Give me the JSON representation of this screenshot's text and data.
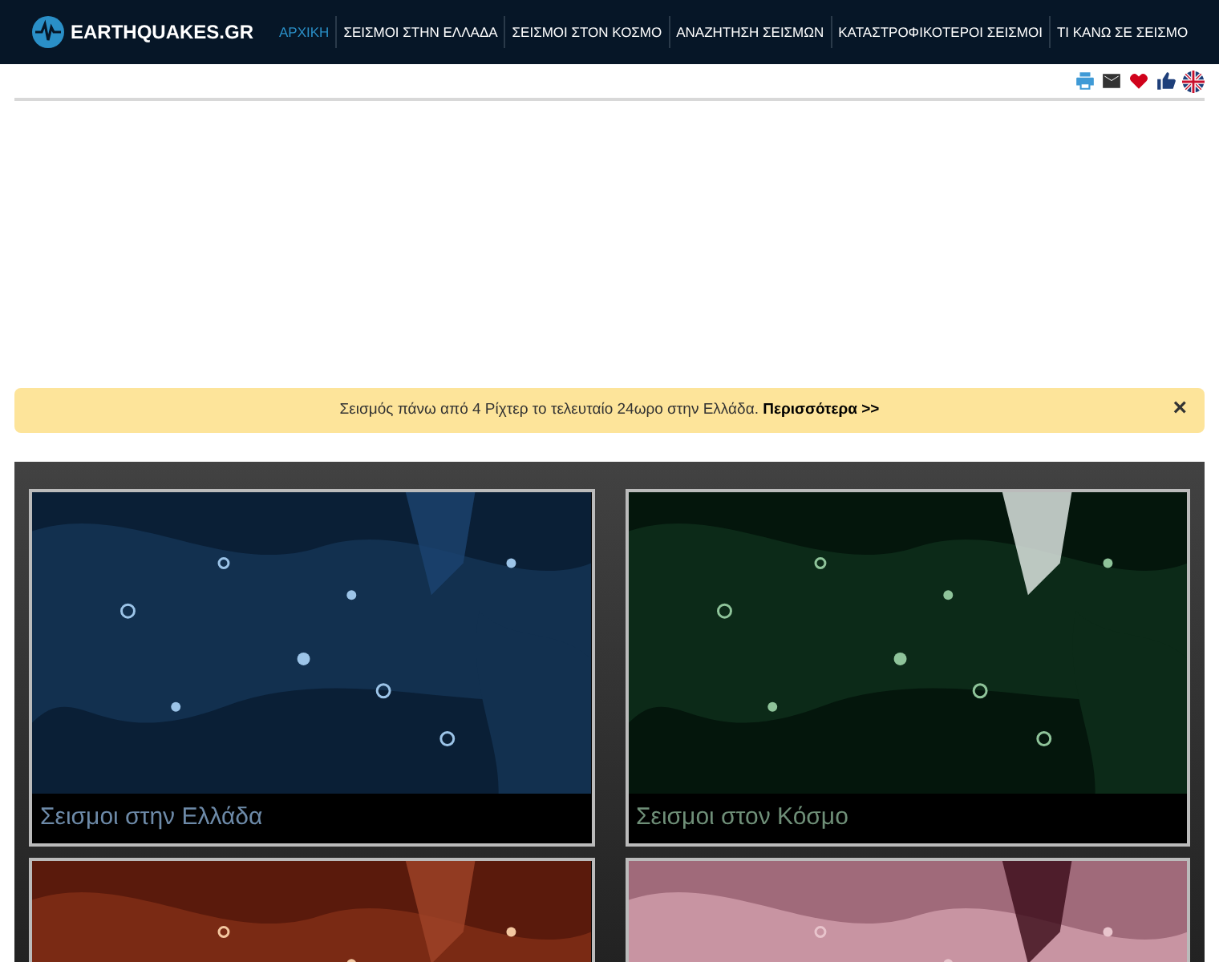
{
  "header": {
    "logo": "EARTHQUAKES.GR",
    "nav": [
      {
        "label": "ΑΡΧΙΚΗ",
        "selected": true
      },
      {
        "label": "ΣΕΙΣΜΟΙ ΣΤΗΝ ΕΛΛΑΔΑ",
        "selected": false
      },
      {
        "label": "ΣΕΙΣΜΟΙ ΣΤΟΝ ΚΟΣΜΟ",
        "selected": false
      },
      {
        "label": "ΑΝΑΖΗΤΗΣΗ ΣΕΙΣΜΩΝ",
        "selected": false
      },
      {
        "label": "ΚΑΤΑΣΤΡΟΦΙΚΟΤΕΡΟΙ ΣΕΙΣΜΟΙ",
        "selected": false
      },
      {
        "label": "ΤΙ ΚΑΝΩ ΣΕ ΣΕΙΣΜΟ",
        "selected": false
      }
    ]
  },
  "alert": {
    "text": "Σεισμός πάνω από 4 Ρίχτερ το τελευταίο 24ωρο στην Ελλάδα.",
    "link": "Περισσότερα >>",
    "close": "×"
  },
  "tiles": [
    {
      "caption": "Σεισμοι στην Ελλάδα",
      "kind": "picture"
    },
    {
      "caption": "Σεισμοι στον Κόσμο",
      "kind": "picture"
    },
    {
      "kind": "picture"
    },
    {
      "kind": "picture"
    }
  ]
}
